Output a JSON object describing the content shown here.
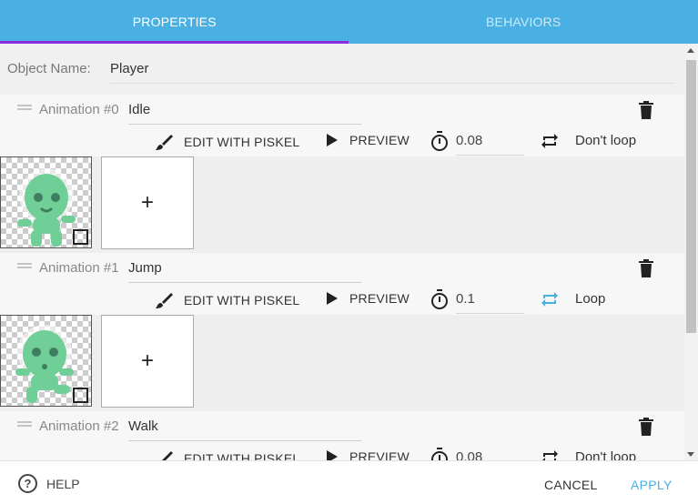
{
  "tabs": [
    {
      "label": "PROPERTIES",
      "active": true
    },
    {
      "label": "BEHAVIORS",
      "active": false
    }
  ],
  "object_name": {
    "label": "Object Name:",
    "value": "Player"
  },
  "animations": [
    {
      "title": "Animation #0",
      "name": "Idle",
      "edit_label": "EDIT WITH PISKEL",
      "preview_label": "PREVIEW",
      "timer": "0.08",
      "loop_label": "Don't loop",
      "looping": false
    },
    {
      "title": "Animation #1",
      "name": "Jump",
      "edit_label": "EDIT WITH PISKEL",
      "preview_label": "PREVIEW",
      "timer": "0.1",
      "loop_label": "Loop",
      "looping": true
    },
    {
      "title": "Animation #2",
      "name": "Walk",
      "edit_label": "EDIT WITH PISKEL",
      "preview_label": "PREVIEW",
      "timer": "0.08",
      "loop_label": "Don't loop",
      "looping": false
    }
  ],
  "add_frame_symbol": "+",
  "footer": {
    "help": "HELP",
    "help_symbol": "?",
    "cancel": "CANCEL",
    "apply": "APPLY"
  },
  "colors": {
    "accent": "#4ab0e4",
    "tab_indicator": "#8a2be2",
    "sprite": "#6fcf97"
  },
  "icons": [
    "paintbrush-icon",
    "play-icon",
    "stopwatch-icon",
    "repeat-icon",
    "trash-icon",
    "help-circle-icon",
    "plus-icon"
  ]
}
